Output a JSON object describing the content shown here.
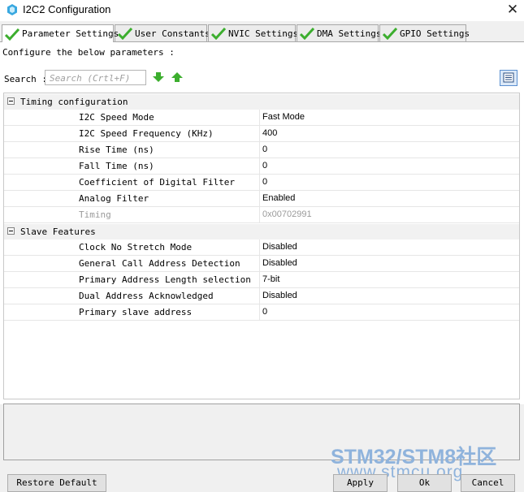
{
  "window": {
    "title": "I2C2 Configuration",
    "close_glyph": "✕"
  },
  "tabs": [
    {
      "label": "Parameter Settings",
      "active": true,
      "icon": "green-check-icon"
    },
    {
      "label": "User Constants",
      "active": false,
      "icon": "green-check-icon"
    },
    {
      "label": "NVIC Settings",
      "active": false,
      "icon": "green-check-icon"
    },
    {
      "label": "DMA Settings",
      "active": false,
      "icon": "green-check-icon"
    },
    {
      "label": "GPIO Settings",
      "active": false,
      "icon": "green-check-icon"
    }
  ],
  "main": {
    "configure_text": "Configure the below parameters :",
    "search_label": "Search :",
    "search_placeholder": "Search (Crtl+F)"
  },
  "groups": [
    {
      "label": "Timing configuration",
      "rows": [
        {
          "name": "I2C Speed Mode",
          "value": "Fast Mode",
          "disabled": false
        },
        {
          "name": "I2C Speed Frequency (KHz)",
          "value": "400",
          "disabled": false
        },
        {
          "name": "Rise Time (ns)",
          "value": "0",
          "disabled": false
        },
        {
          "name": "Fall Time (ns)",
          "value": "0",
          "disabled": false
        },
        {
          "name": "Coefficient of Digital Filter",
          "value": "0",
          "disabled": false
        },
        {
          "name": "Analog Filter",
          "value": "Enabled",
          "disabled": false
        },
        {
          "name": "Timing",
          "value": "0x00702991",
          "disabled": true
        }
      ]
    },
    {
      "label": "Slave Features",
      "rows": [
        {
          "name": "Clock No Stretch Mode",
          "value": "Disabled",
          "disabled": false
        },
        {
          "name": "General Call Address Detection",
          "value": "Disabled",
          "disabled": false
        },
        {
          "name": "Primary Address Length selection",
          "value": "7-bit",
          "disabled": false
        },
        {
          "name": "Dual Address Acknowledged",
          "value": "Disabled",
          "disabled": false
        },
        {
          "name": "Primary slave address",
          "value": "0",
          "disabled": false
        }
      ]
    }
  ],
  "watermark": {
    "line1": "STM32/STM8社区",
    "line2": "www.stmcu.org"
  },
  "buttons": {
    "restore": "Restore Default",
    "apply": "Apply",
    "ok": "Ok",
    "cancel": "Cancel"
  },
  "colors": {
    "check_green": "#3cae2e",
    "watermark": "#8fb3dc",
    "accent_blue": "#5a8fd0"
  }
}
